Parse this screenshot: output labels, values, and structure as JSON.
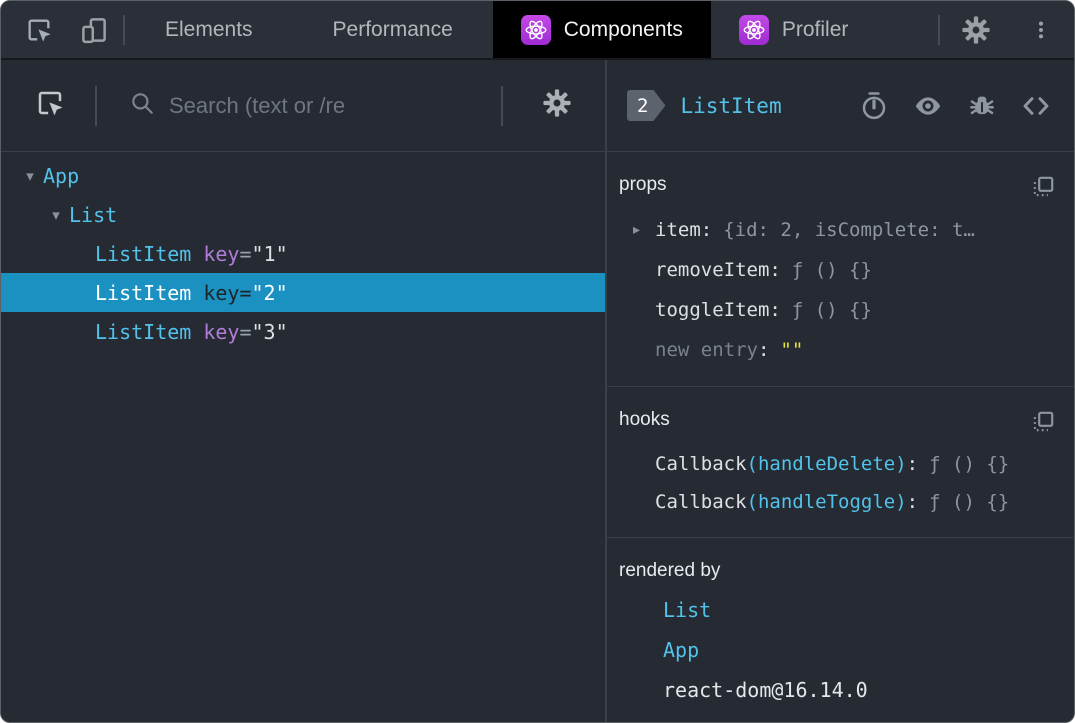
{
  "strings": {
    "colon": ":"
  },
  "icons": {
    "expanded": "▾",
    "collapsed": "▸"
  },
  "topbar": {
    "tabs": {
      "elements": "Elements",
      "performance": "Performance",
      "components": "Components",
      "profiler": "Profiler"
    }
  },
  "left": {
    "search_placeholder": "Search (text or /re",
    "tree": [
      {
        "label": "App",
        "depth": 0,
        "expanded": true
      },
      {
        "label": "List",
        "depth": 1,
        "expanded": true
      },
      {
        "label": "ListItem",
        "attr": "key",
        "eq": "=",
        "value": "\"1\"",
        "depth": 2
      },
      {
        "label": "ListItem",
        "attr": "key",
        "eq": "=",
        "value": "\"2\"",
        "depth": 2,
        "selected": true
      },
      {
        "label": "ListItem",
        "attr": "key",
        "eq": "=",
        "value": "\"3\"",
        "depth": 2
      }
    ]
  },
  "right": {
    "badge": "2",
    "component": "ListItem",
    "props": {
      "title": "props",
      "rows": [
        {
          "name": "item",
          "value": "{id: 2, isComplete: t…",
          "expandable": true
        },
        {
          "name": "removeItem",
          "value": "ƒ () {}"
        },
        {
          "name": "toggleItem",
          "value": "ƒ () {}"
        },
        {
          "name": "new entry",
          "value": "\"\"",
          "editable": true
        }
      ]
    },
    "hooks": {
      "title": "hooks",
      "rows": [
        {
          "fn": "Callback",
          "param": "(handleDelete)",
          "value": "ƒ () {}"
        },
        {
          "fn": "Callback",
          "param": "(handleToggle)",
          "value": "ƒ () {}"
        }
      ]
    },
    "rendered_by": {
      "title": "rendered by",
      "items": [
        {
          "label": "List",
          "link": true
        },
        {
          "label": "App",
          "link": true
        },
        {
          "label": "react-dom@16.14.0",
          "link": false
        }
      ]
    }
  },
  "colors": {
    "accent_cyan": "#52c2ea",
    "attr_purple": "#af7dd9",
    "selection_blue": "#1a91c0",
    "string_yellow": "#e6e332",
    "react_icon_purple": "#b93de0",
    "background": "#262b33",
    "topbar_background": "#2b3038",
    "active_tab_background": "#000000",
    "divider": "#3a4047",
    "text_primary": "#dde0e3",
    "text_muted": "#8e959e"
  }
}
